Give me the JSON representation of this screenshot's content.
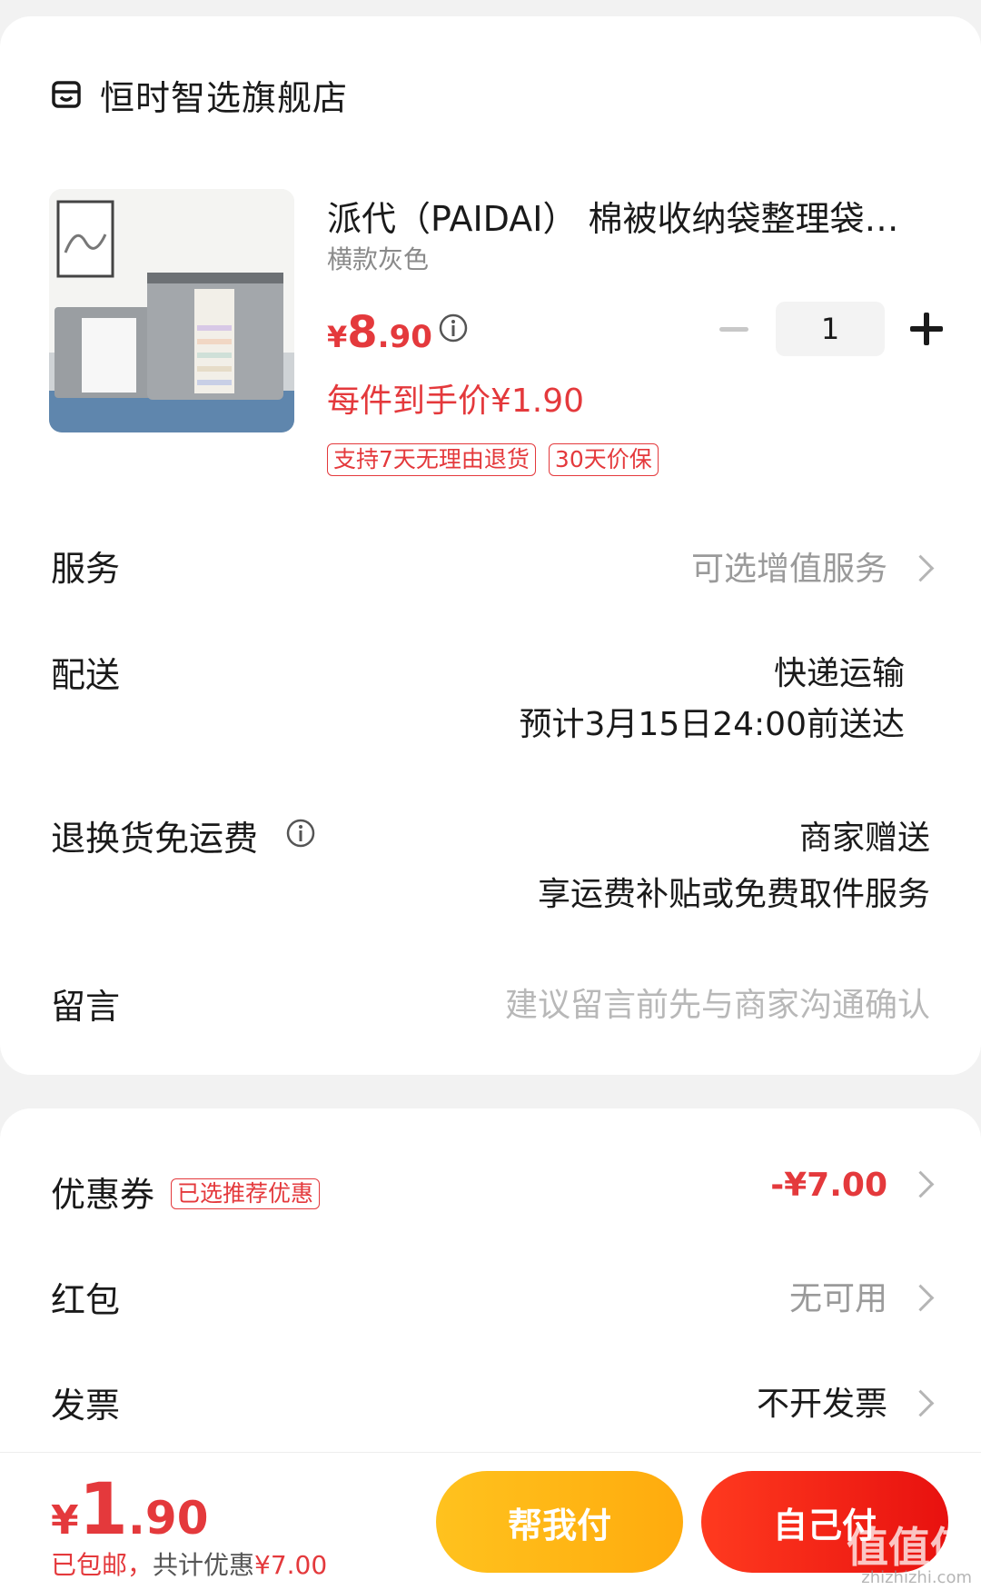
{
  "store": {
    "name": "恒时智选旗舰店",
    "icon": "store-icon"
  },
  "product": {
    "title": "派代（PAIDAI） 棉被收纳袋整理袋…",
    "variant": "横款灰色",
    "price_yen": "¥",
    "price_int": "8",
    "price_dec": ".90",
    "quantity": "1",
    "per_item_price": "每件到手价¥1.90",
    "tags": [
      "支持7天无理由退货",
      "30天价保"
    ]
  },
  "rows": {
    "service": {
      "label": "服务",
      "value": "可选增值服务"
    },
    "delivery": {
      "label": "配送",
      "value1": "快递运输",
      "value2": "预计3月15日24:00前送达"
    },
    "return_shipping": {
      "label": "退换货免运费",
      "value1": "商家赠送",
      "value2": "享运费补贴或免费取件服务"
    },
    "message": {
      "label": "留言",
      "placeholder": "建议留言前先与商家沟通确认"
    }
  },
  "discounts": {
    "coupon": {
      "label": "优惠券",
      "badge": "已选推荐优惠",
      "value": "-¥7.00"
    },
    "red_packet": {
      "label": "红包",
      "value": "无可用"
    },
    "invoice": {
      "label": "发票",
      "value": "不开发票"
    }
  },
  "footer": {
    "total_yen": "¥",
    "total_int": "1",
    "total_dec": ".90",
    "shipping_note": "已包邮，",
    "saving_prefix": "共计优惠",
    "saving_value": "¥7.00",
    "help_pay": "帮我付",
    "self_pay": "自己付",
    "watermark": "值值值",
    "watermark_url": "zhizhizhi.com"
  },
  "colors": {
    "accent": "#e4393c",
    "help_button": "#ffb81a",
    "pay_button": "#f0201a"
  }
}
